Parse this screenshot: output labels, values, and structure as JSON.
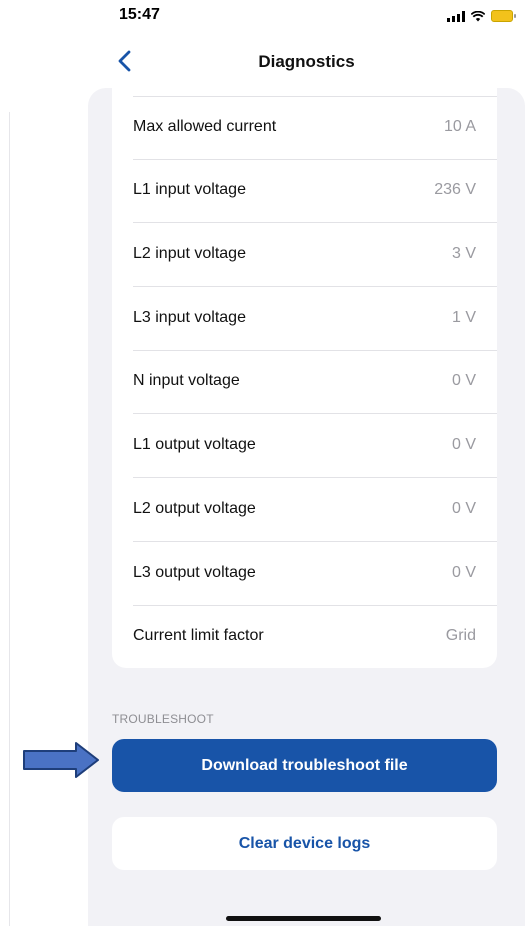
{
  "status_bar": {
    "time": "15:47"
  },
  "nav": {
    "title": "Diagnostics",
    "back_icon": "chevron-left-icon"
  },
  "diagnostics": {
    "rows": [
      {
        "label": "Max allowed current",
        "value": "10 A"
      },
      {
        "label": "L1 input voltage",
        "value": "236 V"
      },
      {
        "label": "L2 input voltage",
        "value": "3 V"
      },
      {
        "label": "L3 input voltage",
        "value": "1 V"
      },
      {
        "label": "N input voltage",
        "value": "0 V"
      },
      {
        "label": "L1 output voltage",
        "value": "0 V"
      },
      {
        "label": "L2 output voltage",
        "value": "0 V"
      },
      {
        "label": "L3 output voltage",
        "value": "0 V"
      },
      {
        "label": "Current limit factor",
        "value": "Grid"
      }
    ]
  },
  "troubleshoot": {
    "section_label": "TROUBLESHOOT",
    "download_label": "Download troubleshoot file",
    "clear_label": "Clear device logs"
  },
  "colors": {
    "accent": "#1854a8",
    "annotation_arrow": "#4a72c4",
    "background": "#f2f2f6",
    "value_text": "#9a9aa0"
  }
}
